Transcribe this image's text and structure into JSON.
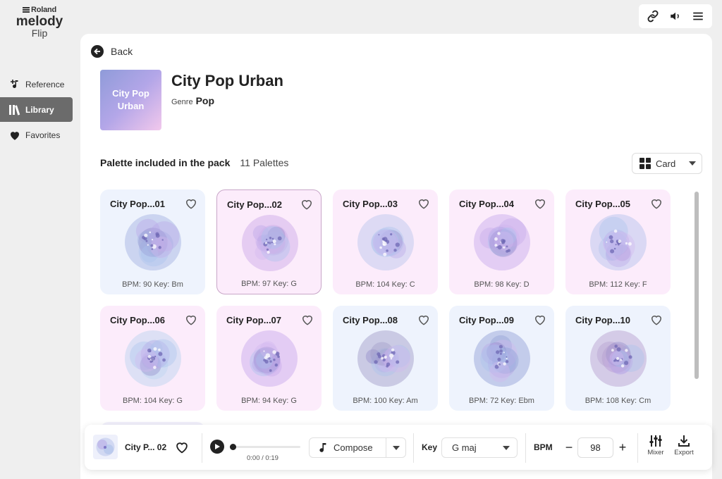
{
  "brand": {
    "company": "Roland",
    "product": "melody",
    "product_sub": "Flip"
  },
  "nav": [
    {
      "label": "Reference",
      "icon": "music-note-plus-icon",
      "active": false
    },
    {
      "label": "Library",
      "icon": "library-books-icon",
      "active": true
    },
    {
      "label": "Favorites",
      "icon": "heart-icon",
      "active": false
    }
  ],
  "topbar": {
    "icons": [
      "link-icon",
      "speaker-icon",
      "menu-icon"
    ]
  },
  "back_label": "Back",
  "pack": {
    "cover_text": "City Pop Urban",
    "title": "City Pop Urban",
    "genre_label": "Genre",
    "genre_value": "Pop"
  },
  "section": {
    "title": "Palette included in the pack",
    "count": "11 Palettes"
  },
  "view_select": {
    "value": "Card"
  },
  "palettes": [
    {
      "name": "City Pop...01",
      "meta": "BPM: 90  Key: Bm",
      "tint": "blue",
      "selected": false,
      "hue": "#9fb0e0"
    },
    {
      "name": "City Pop...02",
      "meta": "BPM: 97  Key: G",
      "tint": "pink",
      "selected": true,
      "hue": "#c9a7e6"
    },
    {
      "name": "City Pop...03",
      "meta": "BPM: 104  Key: C",
      "tint": "pink",
      "selected": false,
      "hue": "#b7c6ec"
    },
    {
      "name": "City Pop...04",
      "meta": "BPM: 98  Key: D",
      "tint": "pink",
      "selected": false,
      "hue": "#c6a8ea"
    },
    {
      "name": "City Pop...05",
      "meta": "BPM: 112  Key: F",
      "tint": "pink",
      "selected": false,
      "hue": "#b1c0ea"
    },
    {
      "name": "City Pop...06",
      "meta": "BPM: 104  Key: G",
      "tint": "pink",
      "selected": false,
      "hue": "#b8d2ee"
    },
    {
      "name": "City Pop...07",
      "meta": "BPM: 94  Key: G",
      "tint": "pink",
      "selected": false,
      "hue": "#c5a6ea"
    },
    {
      "name": "City Pop...08",
      "meta": "BPM: 100  Key: Am",
      "tint": "blue",
      "selected": false,
      "hue": "#9e98c6"
    },
    {
      "name": "City Pop...09",
      "meta": "BPM: 72  Key: Ebm",
      "tint": "blue",
      "selected": false,
      "hue": "#8f9dd4"
    },
    {
      "name": "City Pop...10",
      "meta": "BPM: 108  Key: Cm",
      "tint": "blue",
      "selected": false,
      "hue": "#b39ccc"
    }
  ],
  "player": {
    "track": "City P... 02",
    "time": "0:00 / 0:19",
    "progress": 0,
    "mode": "Compose",
    "key_label": "Key",
    "key_value": "G maj",
    "bpm_label": "BPM",
    "bpm_value": "98",
    "minus": "−",
    "plus": "+",
    "mixer_label": "Mixer",
    "export_label": "Export"
  },
  "colors": {
    "accent_dark": "#222222",
    "nav_active": "#6b6b6b",
    "card_blue": "#eef3fd",
    "card_pink": "#fcecfb"
  }
}
